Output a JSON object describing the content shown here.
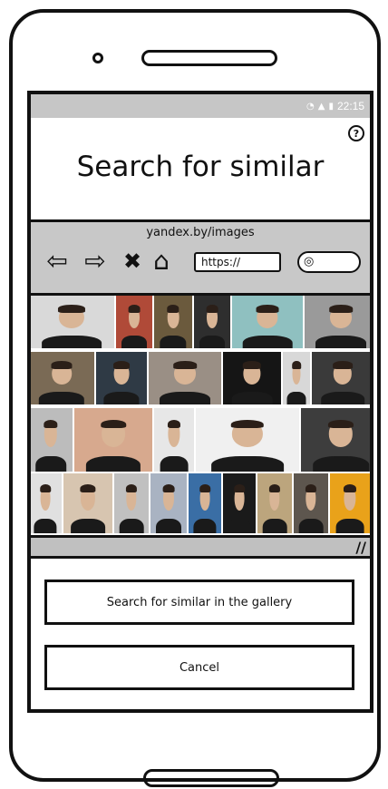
{
  "status_bar": {
    "wifi_icon": "wifi-icon",
    "signal_icon": "signal-icon",
    "battery_icon": "battery-icon",
    "time": "22:15"
  },
  "help_icon": "question-icon",
  "title": "Search for similar",
  "browser": {
    "url": "yandex.by/images",
    "address_field": "https://",
    "back_icon": "back-arrow-icon",
    "forward_icon": "forward-arrow-icon",
    "stop_icon": "close-icon",
    "home_icon": "home-icon",
    "search_icon": "search-icon"
  },
  "gallery": {
    "rows": [
      [
        "#d9d9d9",
        "#b04a38",
        "#6b5a3d",
        "#2e2e2e",
        "#8fc0c0",
        "#9a9a9a"
      ],
      [
        "#7a6a55",
        "#2f3a45",
        "#9a8f85",
        "#151515",
        "#d8d8d8",
        "#3a3a3a"
      ],
      [
        "#bcbcbc",
        "#d7a98e",
        "#e7e7e7",
        "#f0f0f0",
        "#3d3d3d"
      ],
      [
        "#e0e0e0",
        "#d7c5b0",
        "#c0c0c0",
        "#a9b3c2",
        "#3a6ea5",
        "#1a1a1a",
        "#bca57d",
        "#5d564e",
        "#e9a21a"
      ]
    ]
  },
  "resize_icon": "resize-handle-icon",
  "buttons": {
    "search_gallery": "Search for similar in the gallery",
    "cancel": "Cancel"
  }
}
